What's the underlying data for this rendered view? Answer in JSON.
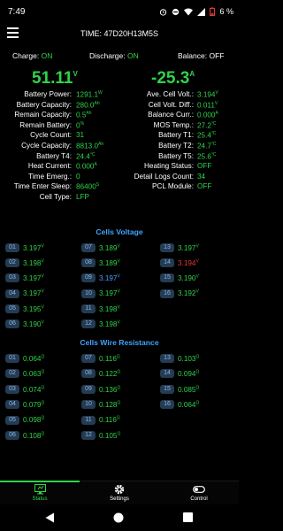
{
  "status_bar": {
    "time": "7:49",
    "battery_percent": "6 %"
  },
  "header": {
    "title": "TIME: 47D20H13M5S"
  },
  "switches": [
    {
      "label": "Charge:",
      "value": "ON",
      "state": "on"
    },
    {
      "label": "Discharge:",
      "value": "ON",
      "state": "on"
    },
    {
      "label": "Balance:",
      "value": "OFF",
      "state": "off"
    }
  ],
  "voltage": {
    "value": "51.11",
    "unit": "V"
  },
  "current": {
    "value": "-25.3",
    "unit": "A"
  },
  "params_left": [
    {
      "label": "Battery Power:",
      "value": "1291.1",
      "unit": "W"
    },
    {
      "label": "Battery Capacity:",
      "value": "280.0",
      "unit": "Ah"
    },
    {
      "label": "Remain Capacity:",
      "value": "0.5",
      "unit": "Ah"
    },
    {
      "label": "Remain Battery:",
      "value": "0",
      "unit": "%"
    },
    {
      "label": "Cycle Count:",
      "value": "31",
      "unit": ""
    },
    {
      "label": "Cycle Capacity:",
      "value": "8813.0",
      "unit": "Ah"
    },
    {
      "label": "Battery T4:",
      "value": "24.4",
      "unit": "°C"
    },
    {
      "label": "Heat Current:",
      "value": "0.000",
      "unit": "A"
    },
    {
      "label": "Time Emerg.:",
      "value": "0",
      "unit": ""
    },
    {
      "label": "Time Enter Sleep:",
      "value": "86400",
      "unit": "S"
    },
    {
      "label": "Cell Type:",
      "value": "LFP",
      "unit": ""
    }
  ],
  "params_right": [
    {
      "label": "Ave. Cell Volt.:",
      "value": "3.194",
      "unit": "V"
    },
    {
      "label": "Cell Volt. Diff.:",
      "value": "0.011",
      "unit": "V"
    },
    {
      "label": "Balance Curr.:",
      "value": "0.000",
      "unit": "A"
    },
    {
      "label": "MOS Temp.:",
      "value": "27.2",
      "unit": "°C"
    },
    {
      "label": "Battery T1:",
      "value": "25.4",
      "unit": "°C"
    },
    {
      "label": "Battery T2:",
      "value": "24.7",
      "unit": "°C"
    },
    {
      "label": "Battery T5:",
      "value": "25.6",
      "unit": "°C"
    },
    {
      "label": "Heating Status:",
      "value": "OFF",
      "unit": ""
    },
    {
      "label": "Detail Logs Count:",
      "value": "34",
      "unit": ""
    },
    {
      "label": "PCL Module:",
      "value": "OFF",
      "unit": ""
    },
    {
      "label": "",
      "value": "",
      "unit": ""
    }
  ],
  "cells_voltage_title": "Cells Voltage",
  "cells_voltage": [
    {
      "id": "01",
      "value": "3.197",
      "unit": "V",
      "state": "normal"
    },
    {
      "id": "02",
      "value": "3.198",
      "unit": "V",
      "state": "normal"
    },
    {
      "id": "03",
      "value": "3.197",
      "unit": "V",
      "state": "normal"
    },
    {
      "id": "04",
      "value": "3.197",
      "unit": "V",
      "state": "normal"
    },
    {
      "id": "05",
      "value": "3.195",
      "unit": "V",
      "state": "normal"
    },
    {
      "id": "06",
      "value": "3.190",
      "unit": "V",
      "state": "normal"
    },
    {
      "id": "07",
      "value": "3.189",
      "unit": "V",
      "state": "normal"
    },
    {
      "id": "08",
      "value": "3.189",
      "unit": "V",
      "state": "normal"
    },
    {
      "id": "09",
      "value": "3.197",
      "unit": "V",
      "state": "high"
    },
    {
      "id": "10",
      "value": "3.197",
      "unit": "V",
      "state": "normal"
    },
    {
      "id": "11",
      "value": "3.198",
      "unit": "V",
      "state": "normal"
    },
    {
      "id": "12",
      "value": "3.198",
      "unit": "V",
      "state": "normal"
    },
    {
      "id": "13",
      "value": "3.197",
      "unit": "V",
      "state": "normal"
    },
    {
      "id": "14",
      "value": "3.194",
      "unit": "V",
      "state": "low"
    },
    {
      "id": "15",
      "value": "3.190",
      "unit": "V",
      "state": "normal"
    },
    {
      "id": "16",
      "value": "3.192",
      "unit": "V",
      "state": "normal"
    }
  ],
  "cells_resistance_title": "Cells Wire Resistance",
  "cells_resistance": [
    {
      "id": "01",
      "value": "0.064",
      "unit": "Ω"
    },
    {
      "id": "02",
      "value": "0.063",
      "unit": "Ω"
    },
    {
      "id": "03",
      "value": "0.074",
      "unit": "Ω"
    },
    {
      "id": "04",
      "value": "0.079",
      "unit": "Ω"
    },
    {
      "id": "05",
      "value": "0.098",
      "unit": "Ω"
    },
    {
      "id": "06",
      "value": "0.108",
      "unit": "Ω"
    },
    {
      "id": "07",
      "value": "0.116",
      "unit": "Ω"
    },
    {
      "id": "08",
      "value": "0.122",
      "unit": "Ω"
    },
    {
      "id": "09",
      "value": "0.136",
      "unit": "Ω"
    },
    {
      "id": "10",
      "value": "0.128",
      "unit": "Ω"
    },
    {
      "id": "11",
      "value": "0.116",
      "unit": "Ω"
    },
    {
      "id": "12",
      "value": "0.105",
      "unit": "Ω"
    },
    {
      "id": "13",
      "value": "0.103",
      "unit": "Ω"
    },
    {
      "id": "14",
      "value": "0.094",
      "unit": "Ω"
    },
    {
      "id": "15",
      "value": "0.085",
      "unit": "Ω"
    },
    {
      "id": "16",
      "value": "0.064",
      "unit": "Ω"
    }
  ],
  "nav": [
    {
      "label": "Status",
      "icon": "status-icon",
      "active": true
    },
    {
      "label": "Settings",
      "icon": "gear-icon",
      "active": false
    },
    {
      "label": "Control",
      "icon": "toggle-icon",
      "active": false
    }
  ],
  "colors": {
    "green": "#2fd34a",
    "blue": "#3fa3ff",
    "red": "#e53935",
    "badge_bg": "#253b52"
  }
}
